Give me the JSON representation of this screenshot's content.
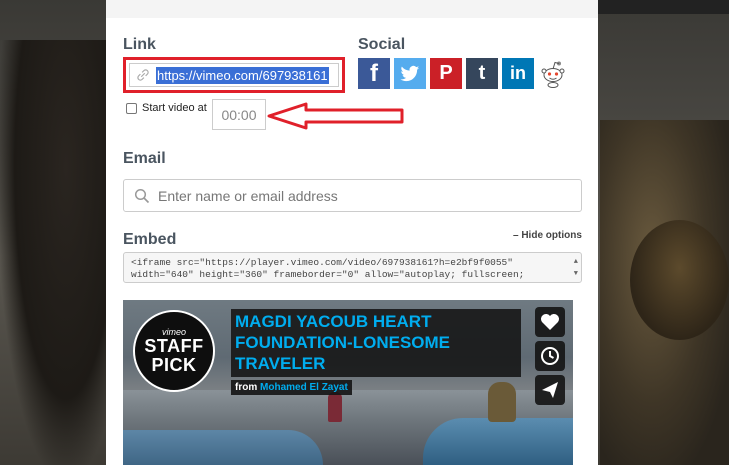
{
  "share": {
    "link_label": "Link",
    "link_url": "https://vimeo.com/697938161",
    "social_label": "Social",
    "social_icons": [
      "facebook-icon",
      "twitter-icon",
      "pinterest-icon",
      "tumblr-icon",
      "linkedin-icon",
      "reddit-icon"
    ],
    "social_glyphs": [
      "f",
      "t",
      "P",
      "t",
      "in",
      ""
    ],
    "start_video_label": "Start video at",
    "start_time_placeholder": "00:00",
    "email_label": "Email",
    "email_placeholder": "Enter name or email address",
    "embed_label": "Embed",
    "hide_options": "– Hide options",
    "embed_code_line1": "<iframe src=\"https://player.vimeo.com/video/697938161?h=e2bf9f0055\"",
    "embed_code_line2": "width=\"640\" height=\"360\" frameborder=\"0\" allow=\"autoplay; fullscreen;"
  },
  "player": {
    "badge_brand": "vimeo",
    "badge_word1": "STAFF",
    "badge_word2": "PICK",
    "title_line1": "MAGDI YACOUB HEART",
    "title_line2": "FOUNDATION-LONESOME",
    "title_line3": "TRAVELER",
    "from_label": "from",
    "from_name": "Mohamed El Zayat"
  },
  "colors": {
    "highlight_border": "#e0202a",
    "selection": "#3a6fd6",
    "vimeo_blue": "#00adef"
  }
}
